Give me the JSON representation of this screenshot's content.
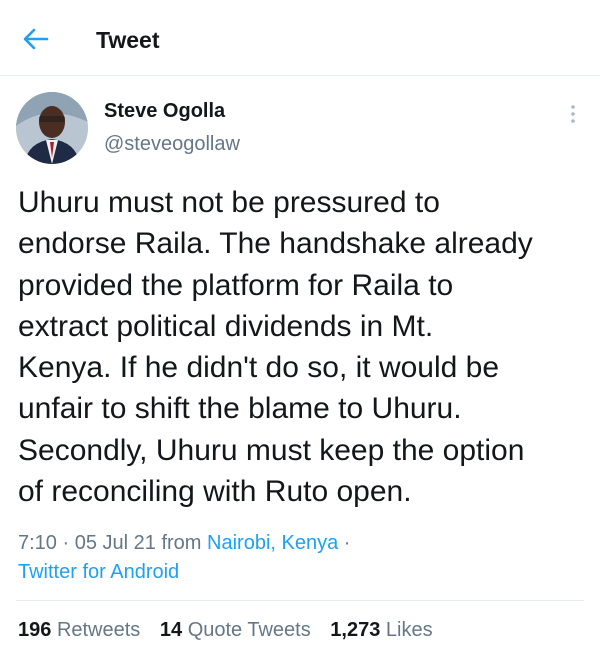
{
  "header": {
    "title": "Tweet",
    "back_icon": "arrow-left-icon"
  },
  "author": {
    "name": "Steve Ogolla",
    "handle": "@steveogollaw",
    "avatar_icon": "profile-photo",
    "more_icon": "vertical-ellipsis-icon"
  },
  "tweet": {
    "text": "Uhuru must not be pressured to\nendorse Raila. The handshake already\nprovided the platform for Raila to\nextract political dividends in Mt.\nKenya. If he didn't do so, it would be\nunfair to shift the blame to Uhuru.\nSecondly, Uhuru must keep the option\nof reconciling with Ruto open.",
    "time": "7:10",
    "separator": "·",
    "date": "05 Jul 21",
    "from_label": "from",
    "location": "Nairobi, Kenya",
    "source": "Twitter for Android"
  },
  "stats": {
    "retweets_count": "196",
    "retweets_label": "Retweets",
    "quotes_count": "14",
    "quotes_label": "Quote Tweets",
    "likes_count": "1,273",
    "likes_label": "Likes"
  },
  "colors": {
    "accent": "#1da1f2",
    "text": "#14171a",
    "muted": "#657786",
    "divider": "#e6ecf0"
  }
}
